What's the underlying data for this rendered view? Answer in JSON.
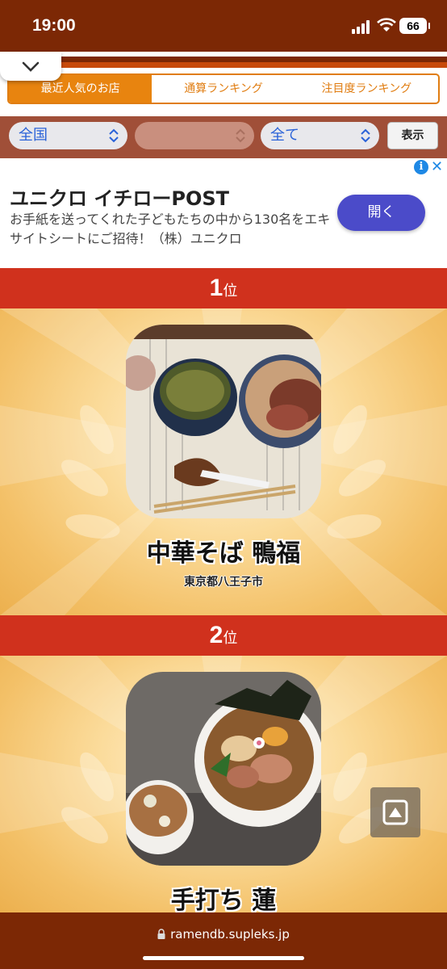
{
  "status": {
    "time": "19:00",
    "battery": "66"
  },
  "tabs": [
    {
      "label": "最近人気のお店",
      "active": true
    },
    {
      "label": "通算ランキング",
      "active": false
    },
    {
      "label": "注目度ランキング",
      "active": false
    }
  ],
  "filters": {
    "region": "全国",
    "sub_region": "",
    "category": "全て",
    "show_label": "表示"
  },
  "ad": {
    "title": "ユニクロ イチローPOST",
    "text": "お手紙を送ってくれた子どもたちの中から130名をエキサイトシートにご招待！（株）ユニクロ",
    "button": "開く",
    "close_glyph": "✕",
    "info_glyph": "i"
  },
  "rankings": [
    {
      "rank": "1",
      "suffix": "位",
      "name": "中華そば 鴨福",
      "location": "東京都八王子市"
    },
    {
      "rank": "2",
      "suffix": "位",
      "name": "手打ち 蓮",
      "location": ""
    }
  ],
  "url": "ramendb.supleks.jp",
  "colors": {
    "brand": "#7c2805",
    "accent": "#e8840f",
    "rank_bar": "#d0311d",
    "ad_button": "#4b4bc9"
  }
}
